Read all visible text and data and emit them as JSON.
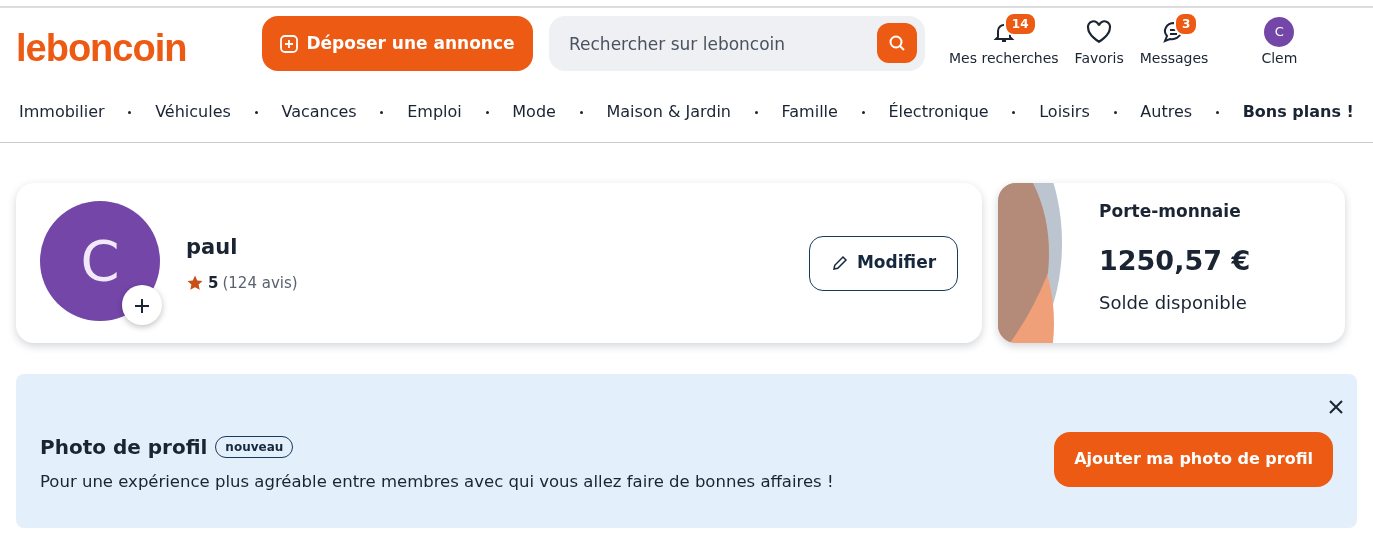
{
  "header": {
    "logo": "leboncoin",
    "post_button": "Déposer une annonce",
    "search": {
      "placeholder": "Rechercher sur leboncoin"
    },
    "actions": [
      {
        "kind": "bell",
        "label": "Mes recherches",
        "count": "14"
      },
      {
        "kind": "heart",
        "label": "Favoris"
      },
      {
        "kind": "chat",
        "label": "Messages",
        "count": "3"
      },
      {
        "kind": "avatar",
        "label": "Clem",
        "initial": "C"
      }
    ]
  },
  "categories": [
    {
      "label": "Immobilier",
      "bold": false
    },
    {
      "label": "Véhicules",
      "bold": false
    },
    {
      "label": "Vacances",
      "bold": false
    },
    {
      "label": "Emploi",
      "bold": false
    },
    {
      "label": "Mode",
      "bold": false
    },
    {
      "label": "Maison & Jardin",
      "bold": false
    },
    {
      "label": "Famille",
      "bold": false
    },
    {
      "label": "Électronique",
      "bold": false
    },
    {
      "label": "Loisirs",
      "bold": false
    },
    {
      "label": "Autres",
      "bold": false
    },
    {
      "label": "Bons plans !",
      "bold": true
    }
  ],
  "profile": {
    "initial": "C",
    "name": "paul",
    "rating": "5",
    "reviews": "(124 avis)",
    "edit_button": "Modifier"
  },
  "wallet": {
    "title": "Porte-monnaie",
    "amount": "1250,57 €",
    "caption": "Solde disponible"
  },
  "banner": {
    "title": "Photo de profil",
    "tag": "nouveau",
    "text": "Pour une expérience plus agréable entre membres avec qui vous allez faire de bonnes affaires !",
    "button": "Ajouter ma photo de profil"
  }
}
